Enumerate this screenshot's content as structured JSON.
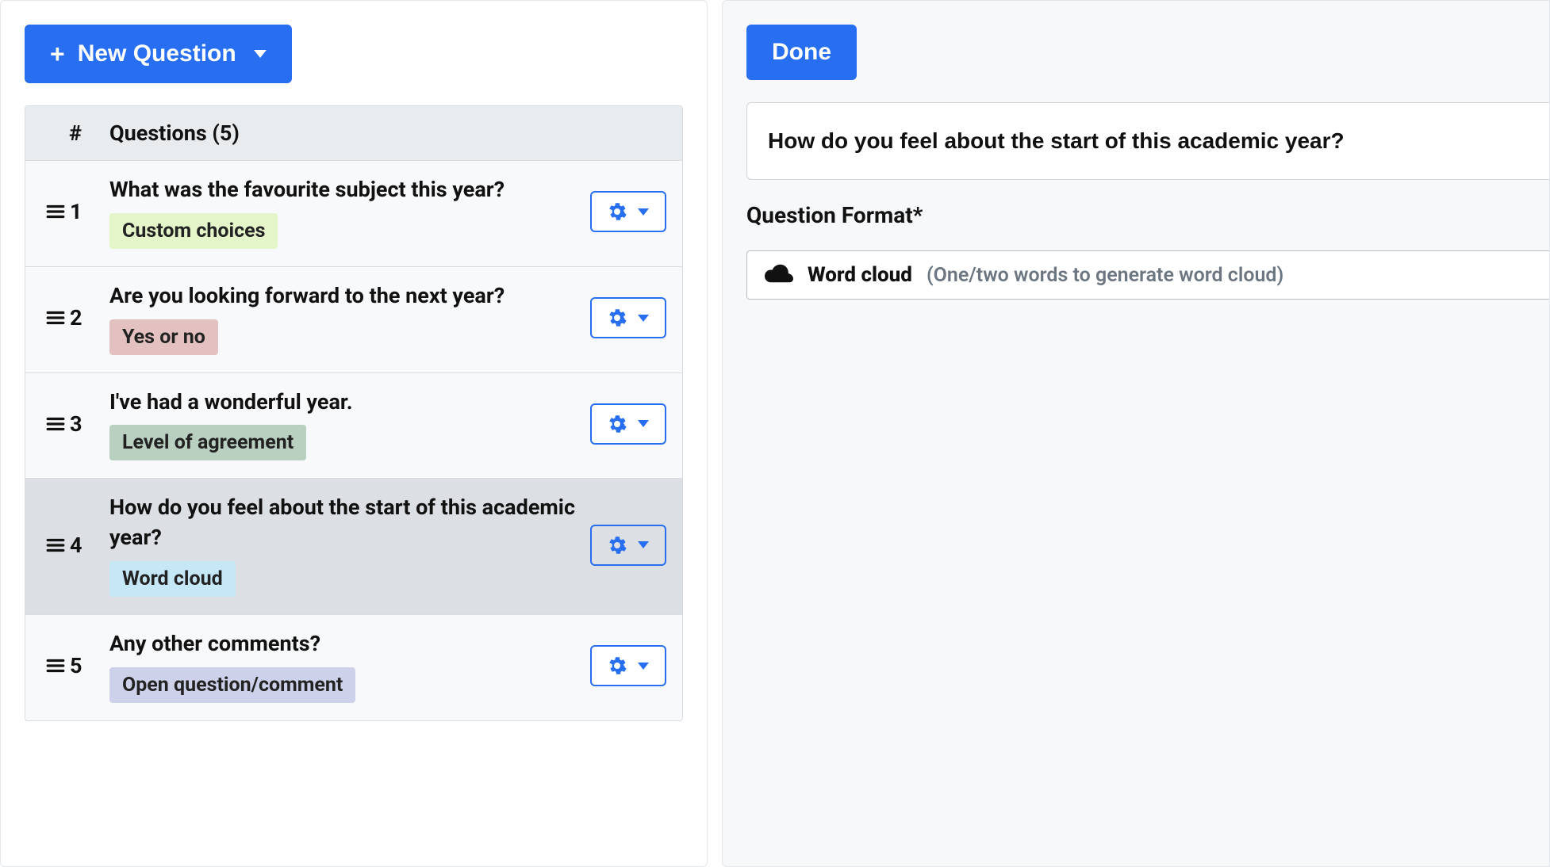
{
  "left": {
    "new_question_label": "New Question",
    "questions_header_num": "#",
    "questions_header_title": "Questions (5)",
    "rows": [
      {
        "num": "1",
        "text": "What was the favourite subject this year?",
        "tag": "Custom choices",
        "tag_class": "tag-custom",
        "selected": false
      },
      {
        "num": "2",
        "text": "Are you looking forward to the next year?",
        "tag": "Yes or no",
        "tag_class": "tag-yesno",
        "selected": false
      },
      {
        "num": "3",
        "text": "I've had a wonderful year.",
        "tag": "Level of agreement",
        "tag_class": "tag-agree",
        "selected": false
      },
      {
        "num": "4",
        "text": "How do you feel about the start of this academic year?",
        "tag": "Word cloud",
        "tag_class": "tag-cloud",
        "selected": true
      },
      {
        "num": "5",
        "text": "Any other comments?",
        "tag": "Open question/comment",
        "tag_class": "tag-open",
        "selected": false
      }
    ]
  },
  "right": {
    "done_label": "Done",
    "question_value": "How do you feel about the start of this academic year?",
    "format_label": "Question Format*",
    "format_selected_name": "Word cloud",
    "format_selected_hint": "(One/two words to generate word cloud)"
  }
}
